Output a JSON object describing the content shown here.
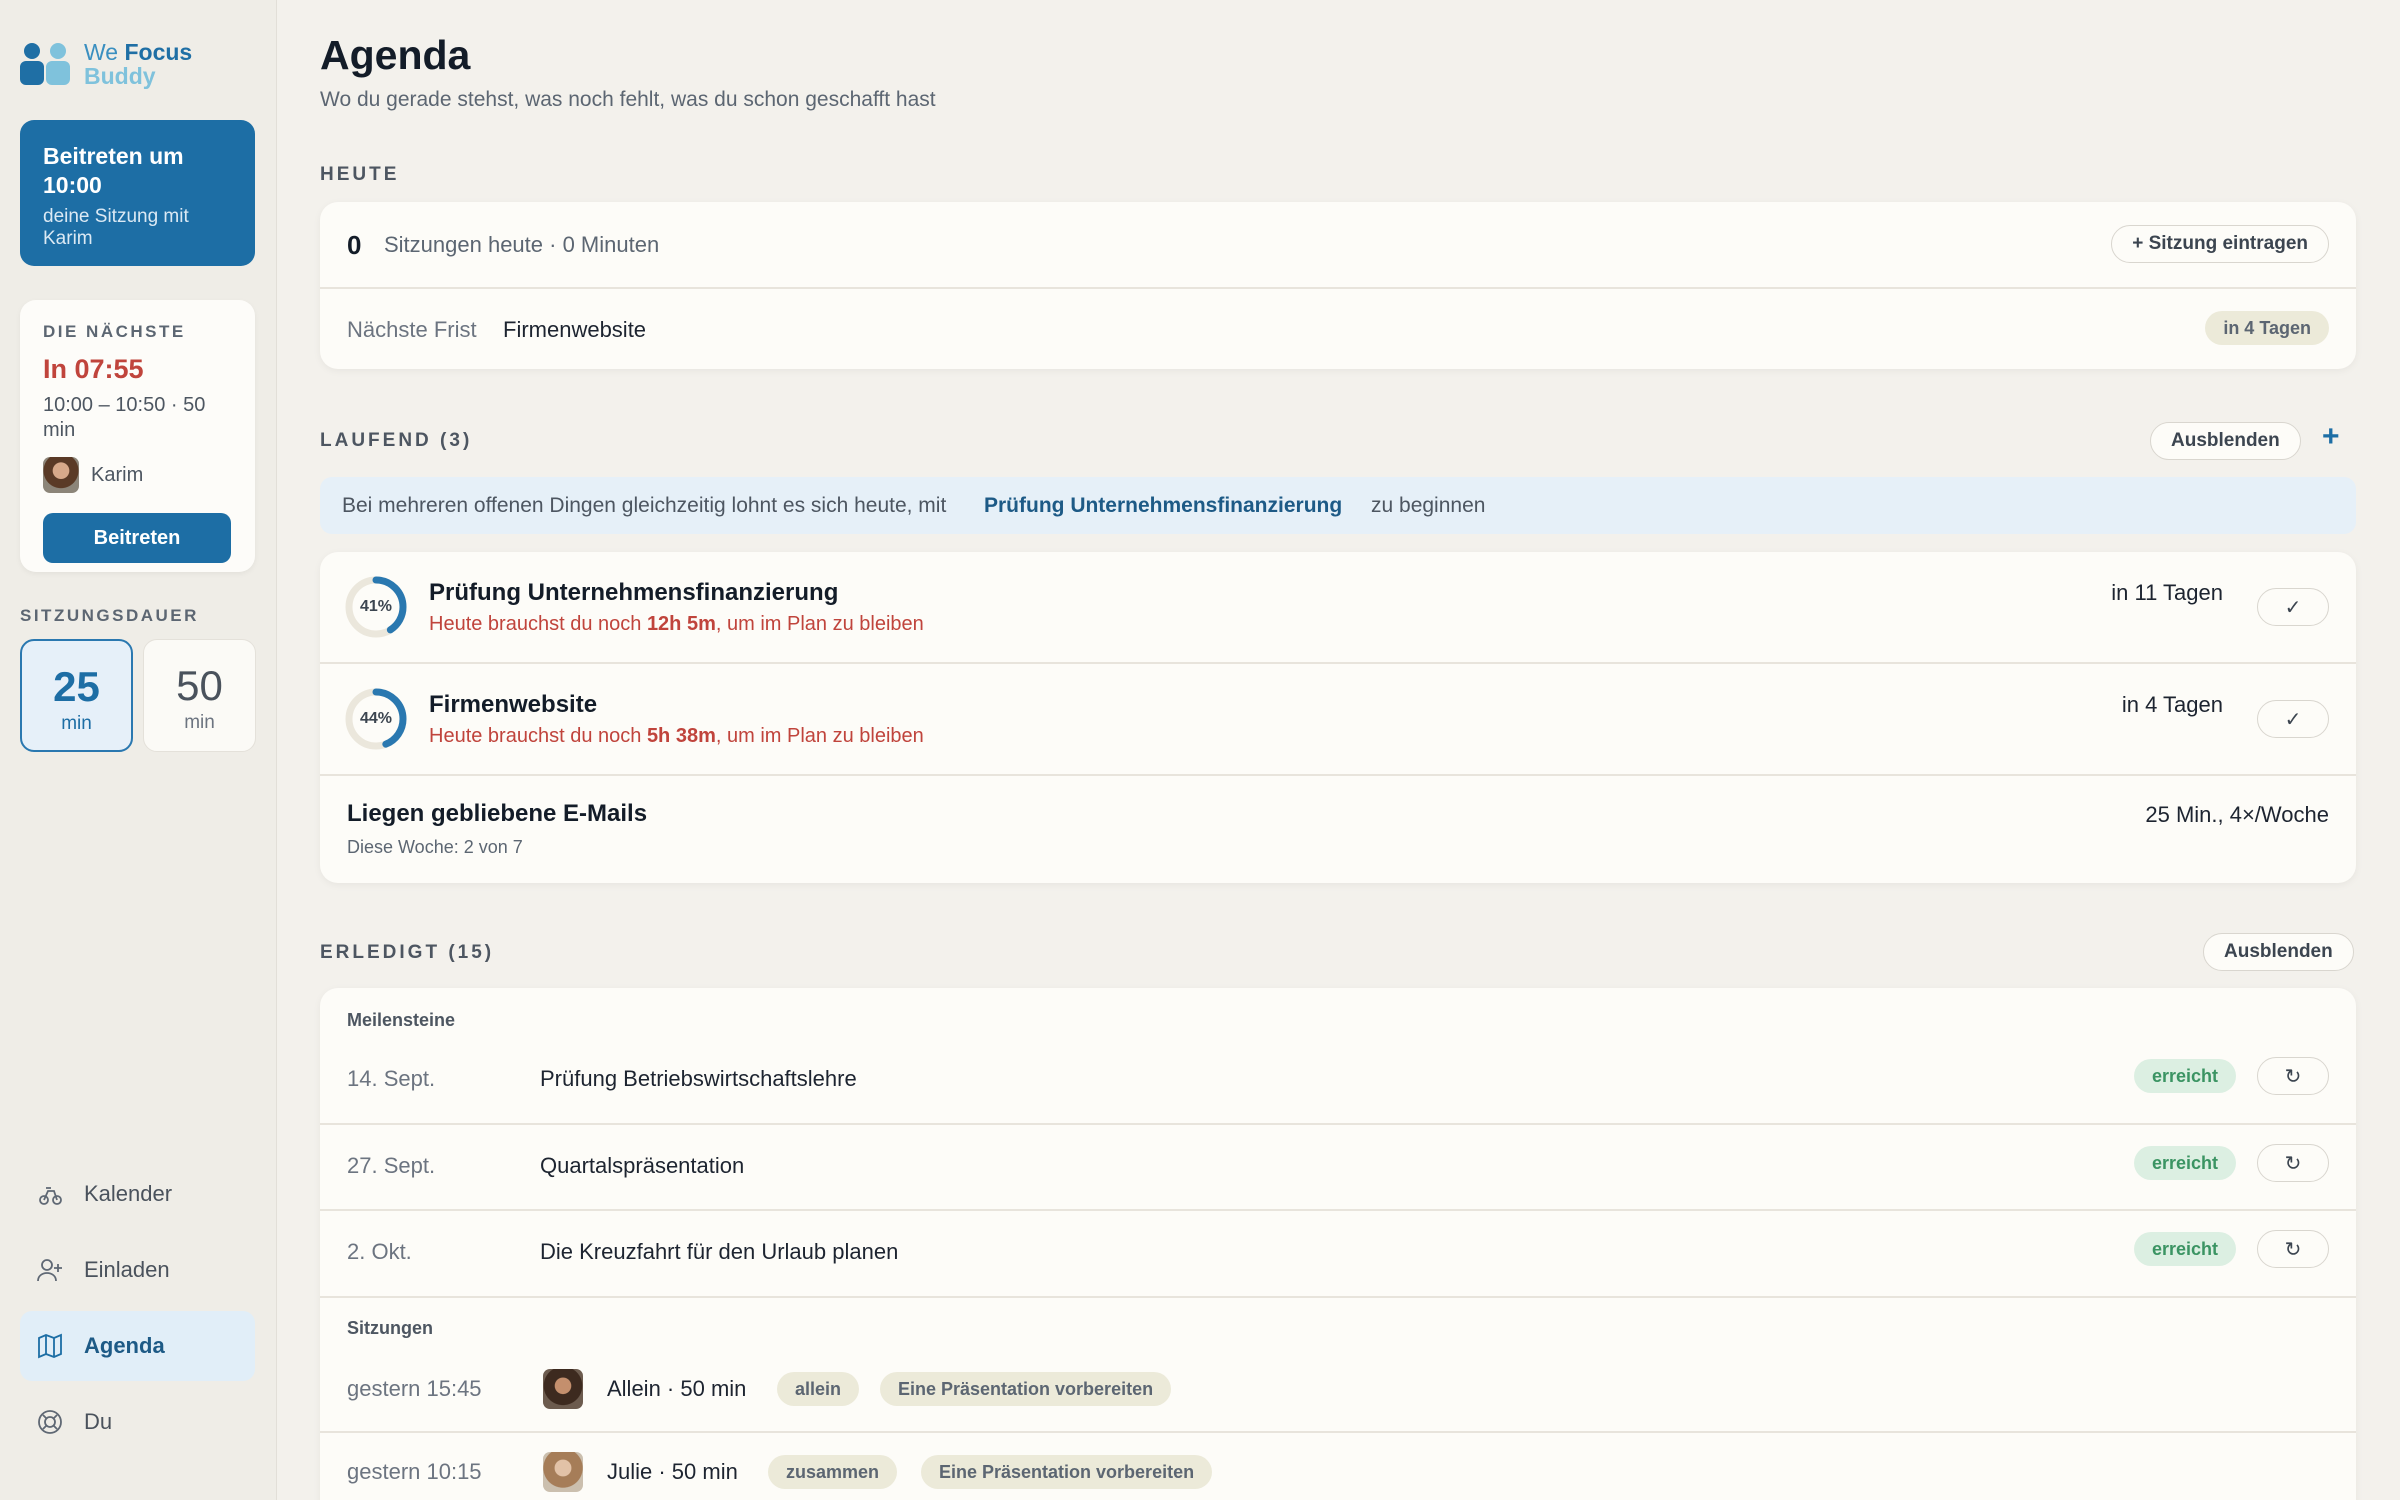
{
  "logo": {
    "we": "We",
    "focus": "Focus",
    "buddy": "Buddy"
  },
  "join_card": {
    "title": "Beitreten um 10:00",
    "subtitle": "deine Sitzung mit Karim"
  },
  "next": {
    "label": "DIE NÄCHSTE",
    "countdown": "In 07:55",
    "time": "10:00 – 10:50 · 50 min",
    "partner": "Karim",
    "join_button": "Beitreten"
  },
  "duration": {
    "label": "SITZUNGSDAUER",
    "options": [
      {
        "value": "25",
        "unit": "min",
        "selected": true
      },
      {
        "value": "50",
        "unit": "min",
        "selected": false
      }
    ]
  },
  "nav": [
    {
      "label": "Kalender",
      "icon": "calendar-icon"
    },
    {
      "label": "Einladen",
      "icon": "add-user-icon"
    },
    {
      "label": "Agenda",
      "icon": "map-icon",
      "active": true
    },
    {
      "label": "Du",
      "icon": "profile-icon"
    }
  ],
  "page": {
    "title": "Agenda",
    "subtitle": "Wo du gerade stehst, was noch fehlt, was du schon geschafft hast"
  },
  "today": {
    "label": "HEUTE",
    "count": "0",
    "summary": "Sitzungen heute · 0 Minuten",
    "add_button": "+ Sitzung eintragen",
    "deadline_label": "Nächste Frist",
    "deadline_name": "Firmenwebsite",
    "deadline_in": "in 4 Tagen"
  },
  "running": {
    "label": "LAUFEND (3)",
    "hide_button": "Ausblenden",
    "add_icon": "+",
    "hint_prefix": "Bei mehreren offenen Dingen gleichzeitig lohnt es sich heute, mit",
    "hint_project": "Prüfung Unternehmensfinanzierung",
    "hint_suffix": "zu beginnen",
    "items": [
      {
        "percent": 41,
        "percent_label": "41%",
        "name": "Prüfung Unternehmensfinanzierung",
        "need_prefix": "Heute brauchst du noch",
        "need_amount": "12h 5m",
        "need_suffix": ", um im Plan zu bleiben",
        "due": "in 11 Tagen",
        "check": "✓"
      },
      {
        "percent": 44,
        "percent_label": "44%",
        "name": "Firmenwebsite",
        "need_prefix": "Heute brauchst du noch",
        "need_amount": "5h 38m",
        "need_suffix": ", um im Plan zu bleiben",
        "due": "in 4 Tagen",
        "check": "✓"
      }
    ],
    "habit": {
      "name": "Liegen gebliebene E-Mails",
      "progress": "Diese Woche: 2 von 7",
      "schedule": "25 Min., 4×/Woche"
    }
  },
  "done": {
    "label": "ERLEDIGT (15)",
    "hide_button": "Ausblenden",
    "milestones_label": "Meilensteine",
    "milestones": [
      {
        "date": "14. Sept.",
        "name": "Prüfung Betriebswirtschaftslehre",
        "status": "erreicht"
      },
      {
        "date": "27. Sept.",
        "name": "Quartalspräsentation",
        "status": "erreicht"
      },
      {
        "date": "2. Okt.",
        "name": "Die Kreuzfahrt für den Urlaub planen",
        "status": "erreicht"
      }
    ],
    "undo_icon": "↻",
    "sessions_label": "Sitzungen",
    "sessions": [
      {
        "time": "gestern 15:45",
        "who": "Allein · 50 min",
        "mode": "allein",
        "task": "Eine Präsentation vorbereiten"
      },
      {
        "time": "gestern 10:15",
        "who": "Julie · 50 min",
        "mode": "zusammen",
        "task": "Eine Präsentation vorbereiten"
      }
    ]
  },
  "colors": {
    "accent": "#1d6ea5",
    "danger": "#c0443c",
    "success": "#3b9463",
    "background": "#f3f1ec"
  }
}
